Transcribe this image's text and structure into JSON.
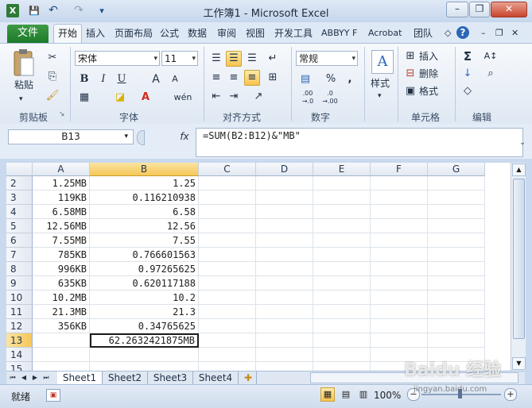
{
  "window": {
    "title": "工作簿1 - Microsoft Excel",
    "controls": {
      "minimize": "–",
      "restore": "❐",
      "close": "✕"
    },
    "quick_access": {
      "save": "💾",
      "undo": "↶",
      "redo": "↷",
      "customize": "▾"
    }
  },
  "tabs": {
    "file": "文件",
    "items": [
      "开始",
      "插入",
      "页面布局",
      "公式",
      "数据",
      "审阅",
      "视图",
      "开发工具",
      "ABBYY F",
      "Acrobat",
      "团队"
    ],
    "active": "开始"
  },
  "ribbon": {
    "groups": [
      "剪贴板",
      "字体",
      "对齐方式",
      "数字",
      "单元格",
      "编辑"
    ],
    "clipboard": {
      "paste": "粘贴"
    },
    "font": {
      "name": "宋体",
      "size": "11",
      "bold": "B",
      "italic": "I",
      "underline": "U",
      "grow": "A",
      "shrink": "A",
      "wen": "wén"
    },
    "number": {
      "format": "常规",
      "percent": "%",
      "comma": ",",
      "inc": ".00 →.0",
      "dec": ".0 →.00"
    },
    "styles": {
      "label": "样式"
    },
    "cells": {
      "insert": "插入",
      "delete": "删除",
      "format": "格式"
    },
    "editing": {
      "sum": "Σ",
      "fill": "↓",
      "clear": "◇"
    }
  },
  "formula_bar": {
    "name_box": "B13",
    "fx": "fx",
    "formula": "=SUM(B2:B12)&\"MB\""
  },
  "grid": {
    "columns": [
      "A",
      "B",
      "C",
      "D",
      "E",
      "F",
      "G"
    ],
    "selected_column": "B",
    "selected_row": "13",
    "rows": [
      {
        "row": "2",
        "a": "1.25MB",
        "b": "1.25"
      },
      {
        "row": "3",
        "a": "119KB",
        "b": "0.116210938"
      },
      {
        "row": "4",
        "a": "6.58MB",
        "b": "6.58"
      },
      {
        "row": "5",
        "a": "12.56MB",
        "b": "12.56"
      },
      {
        "row": "6",
        "a": "7.55MB",
        "b": "7.55"
      },
      {
        "row": "7",
        "a": "785KB",
        "b": "0.766601563"
      },
      {
        "row": "8",
        "a": "996KB",
        "b": "0.97265625"
      },
      {
        "row": "9",
        "a": "635KB",
        "b": "0.620117188"
      },
      {
        "row": "10",
        "a": "10.2MB",
        "b": "10.2"
      },
      {
        "row": "11",
        "a": "21.3MB",
        "b": "21.3"
      },
      {
        "row": "12",
        "a": "356KB",
        "b": "0.34765625"
      },
      {
        "row": "13",
        "a": "",
        "b": "62.2632421875MB"
      },
      {
        "row": "14",
        "a": "",
        "b": ""
      },
      {
        "row": "15",
        "a": "",
        "b": ""
      }
    ]
  },
  "sheets": {
    "items": [
      "Sheet1",
      "Sheet2",
      "Sheet3",
      "Sheet4"
    ],
    "active": "Sheet1"
  },
  "status_bar": {
    "mode": "就绪",
    "zoom": "100%",
    "watermark": "Baidu 经验",
    "url": "jingyan.baidu.com"
  }
}
